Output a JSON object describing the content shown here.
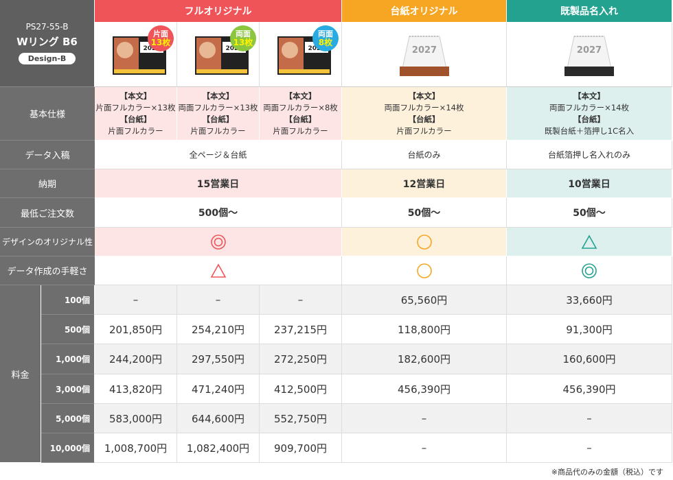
{
  "product": {
    "code": "PS27-55-B",
    "name": "Wリング B6",
    "design": "Design-B"
  },
  "headers": {
    "full": "フルオリジナル",
    "daishi": "台紙オリジナル",
    "kisei": "既製品名入れ"
  },
  "badges": [
    {
      "side": "片面",
      "count": "13枚",
      "color": "#ef5459"
    },
    {
      "side": "両面",
      "count": "13枚",
      "color": "#8cc63f"
    },
    {
      "side": "両面",
      "count": "8枚",
      "color": "#29abe2"
    }
  ],
  "calendar_year": "2027",
  "rows": {
    "spec": "基本仕様",
    "data": "データ入稿",
    "delivery": "納期",
    "min_order": "最低ご注文数",
    "originality": "デザインのオリジナル性",
    "ease": "データ作成の手軽さ",
    "price": "料金"
  },
  "spec": {
    "full1": {
      "body_t": "【本文】",
      "body": "片面フルカラー×13枚",
      "base_t": "【台紙】",
      "base": "片面フルカラー"
    },
    "full2": {
      "body_t": "【本文】",
      "body": "両面フルカラー×13枚",
      "base_t": "【台紙】",
      "base": "片面フルカラー"
    },
    "full3": {
      "body_t": "【本文】",
      "body": "両面フルカラー×8枚",
      "base_t": "【台紙】",
      "base": "片面フルカラー"
    },
    "daishi": {
      "body_t": "【本文】",
      "body": "両面フルカラー×14枚",
      "base_t": "【台紙】",
      "base": "片面フルカラー"
    },
    "kisei": {
      "body_t": "【本文】",
      "body": "両面フルカラー×14枚",
      "base_t": "【台紙】",
      "base": "既製台紙＋箔押し1C名入"
    }
  },
  "data_entry": {
    "full": "全ページ＆台紙",
    "daishi": "台紙のみ",
    "kisei": "台紙箔押し名入れのみ"
  },
  "delivery": {
    "full": "15営業日",
    "daishi": "12営業日",
    "kisei": "10営業日"
  },
  "min_order": {
    "full": "500個〜",
    "daishi": "50個〜",
    "kisei": "50個〜"
  },
  "originality": {
    "full": "double-circle",
    "daishi": "circle",
    "kisei": "triangle"
  },
  "ease": {
    "full": "triangle",
    "daishi": "circle",
    "kisei": "double-circle"
  },
  "colors": {
    "full": "#ef5459",
    "daishi": "#f6a623",
    "kisei": "#23a290"
  },
  "prices": [
    {
      "qty": "100個",
      "values": [
        "–",
        "–",
        "–",
        "65,560円",
        "33,660円"
      ]
    },
    {
      "qty": "500個",
      "values": [
        "201,850円",
        "254,210円",
        "237,215円",
        "118,800円",
        "91,300円"
      ]
    },
    {
      "qty": "1,000個",
      "values": [
        "244,200円",
        "297,550円",
        "272,250円",
        "182,600円",
        "160,600円"
      ]
    },
    {
      "qty": "3,000個",
      "values": [
        "413,820円",
        "471,240円",
        "412,500円",
        "456,390円",
        "456,390円"
      ]
    },
    {
      "qty": "5,000個",
      "values": [
        "583,000円",
        "644,600円",
        "552,750円",
        "–",
        "–"
      ]
    },
    {
      "qty": "10,000個",
      "values": [
        "1,008,700円",
        "1,082,400円",
        "909,700円",
        "–",
        "–"
      ]
    }
  ],
  "footnote": "※商品代のみの金額（税込）です"
}
